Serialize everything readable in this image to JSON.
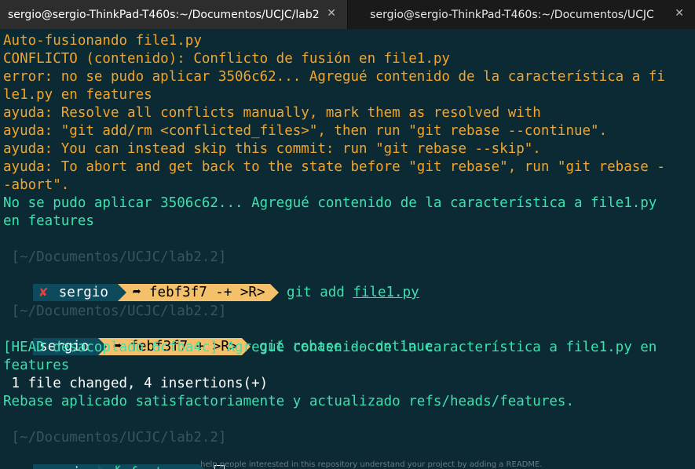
{
  "tabs": [
    {
      "title": "sergio@sergio-ThinkPad-T460s:~/Documentos/UCJC/lab2.2",
      "close": "✕"
    },
    {
      "title": "sergio@sergio-ThinkPad-T460s:~/Documentos/UCJC",
      "close": "✕"
    }
  ],
  "output1": [
    "Auto-fusionando file1.py",
    "CONFLICTO (contenido): Conflicto de fusión en file1.py",
    "error: no se pudo aplicar 3506c62... Agregué contenido de la característica a fi",
    "le1.py en features",
    "ayuda: Resolve all conflicts manually, mark them as resolved with",
    "ayuda: \"git add/rm <conflicted_files>\", then run \"git rebase --continue\".",
    "ayuda: You can instead skip this commit: run \"git rebase --skip\".",
    "ayuda: To abort and get back to the state before \"git rebase\", run \"git rebase -",
    "-abort\"."
  ],
  "output2": [
    "No se pudo aplicar 3506c62... Agregué contenido de la característica a file1.py",
    "en features"
  ],
  "prompt1": {
    "path": " [~/Documentos/UCJC/lab2.2]",
    "error_mark": "✘",
    "user": "sergio",
    "git_status": "➦ febf3f7 -+ >R>",
    "command": "git add",
    "arg": "file1.py"
  },
  "prompt2": {
    "path": " [~/Documentos/UCJC/lab2.2]",
    "user": "sergio",
    "git_status": "➦ febf3f7 + >R>",
    "command": "git rebase --continue"
  },
  "output3": [
    "[HEAD desacoplado 6cfba4c] Agregué contenido de la característica a file1.py en",
    "features",
    " 1 file changed, 4 insertions(+)",
    "Rebase aplicado satisfactoriamente y actualizado refs/heads/features."
  ],
  "prompt3": {
    "path": " [~/Documentos/UCJC/lab2.2]",
    "user": "sergio",
    "branch_icon": "ᚴ",
    "branch": "features"
  },
  "bleed_text": "help people interested in this repository understand your project by adding a README.",
  "colors": {
    "background": "#0b2a33",
    "orange": "#f0a531",
    "teal": "#3fe0b0",
    "prompt_blue": "#0d4a5c",
    "prompt_yellow": "#f4c06a",
    "error_red": "#e8413d"
  }
}
